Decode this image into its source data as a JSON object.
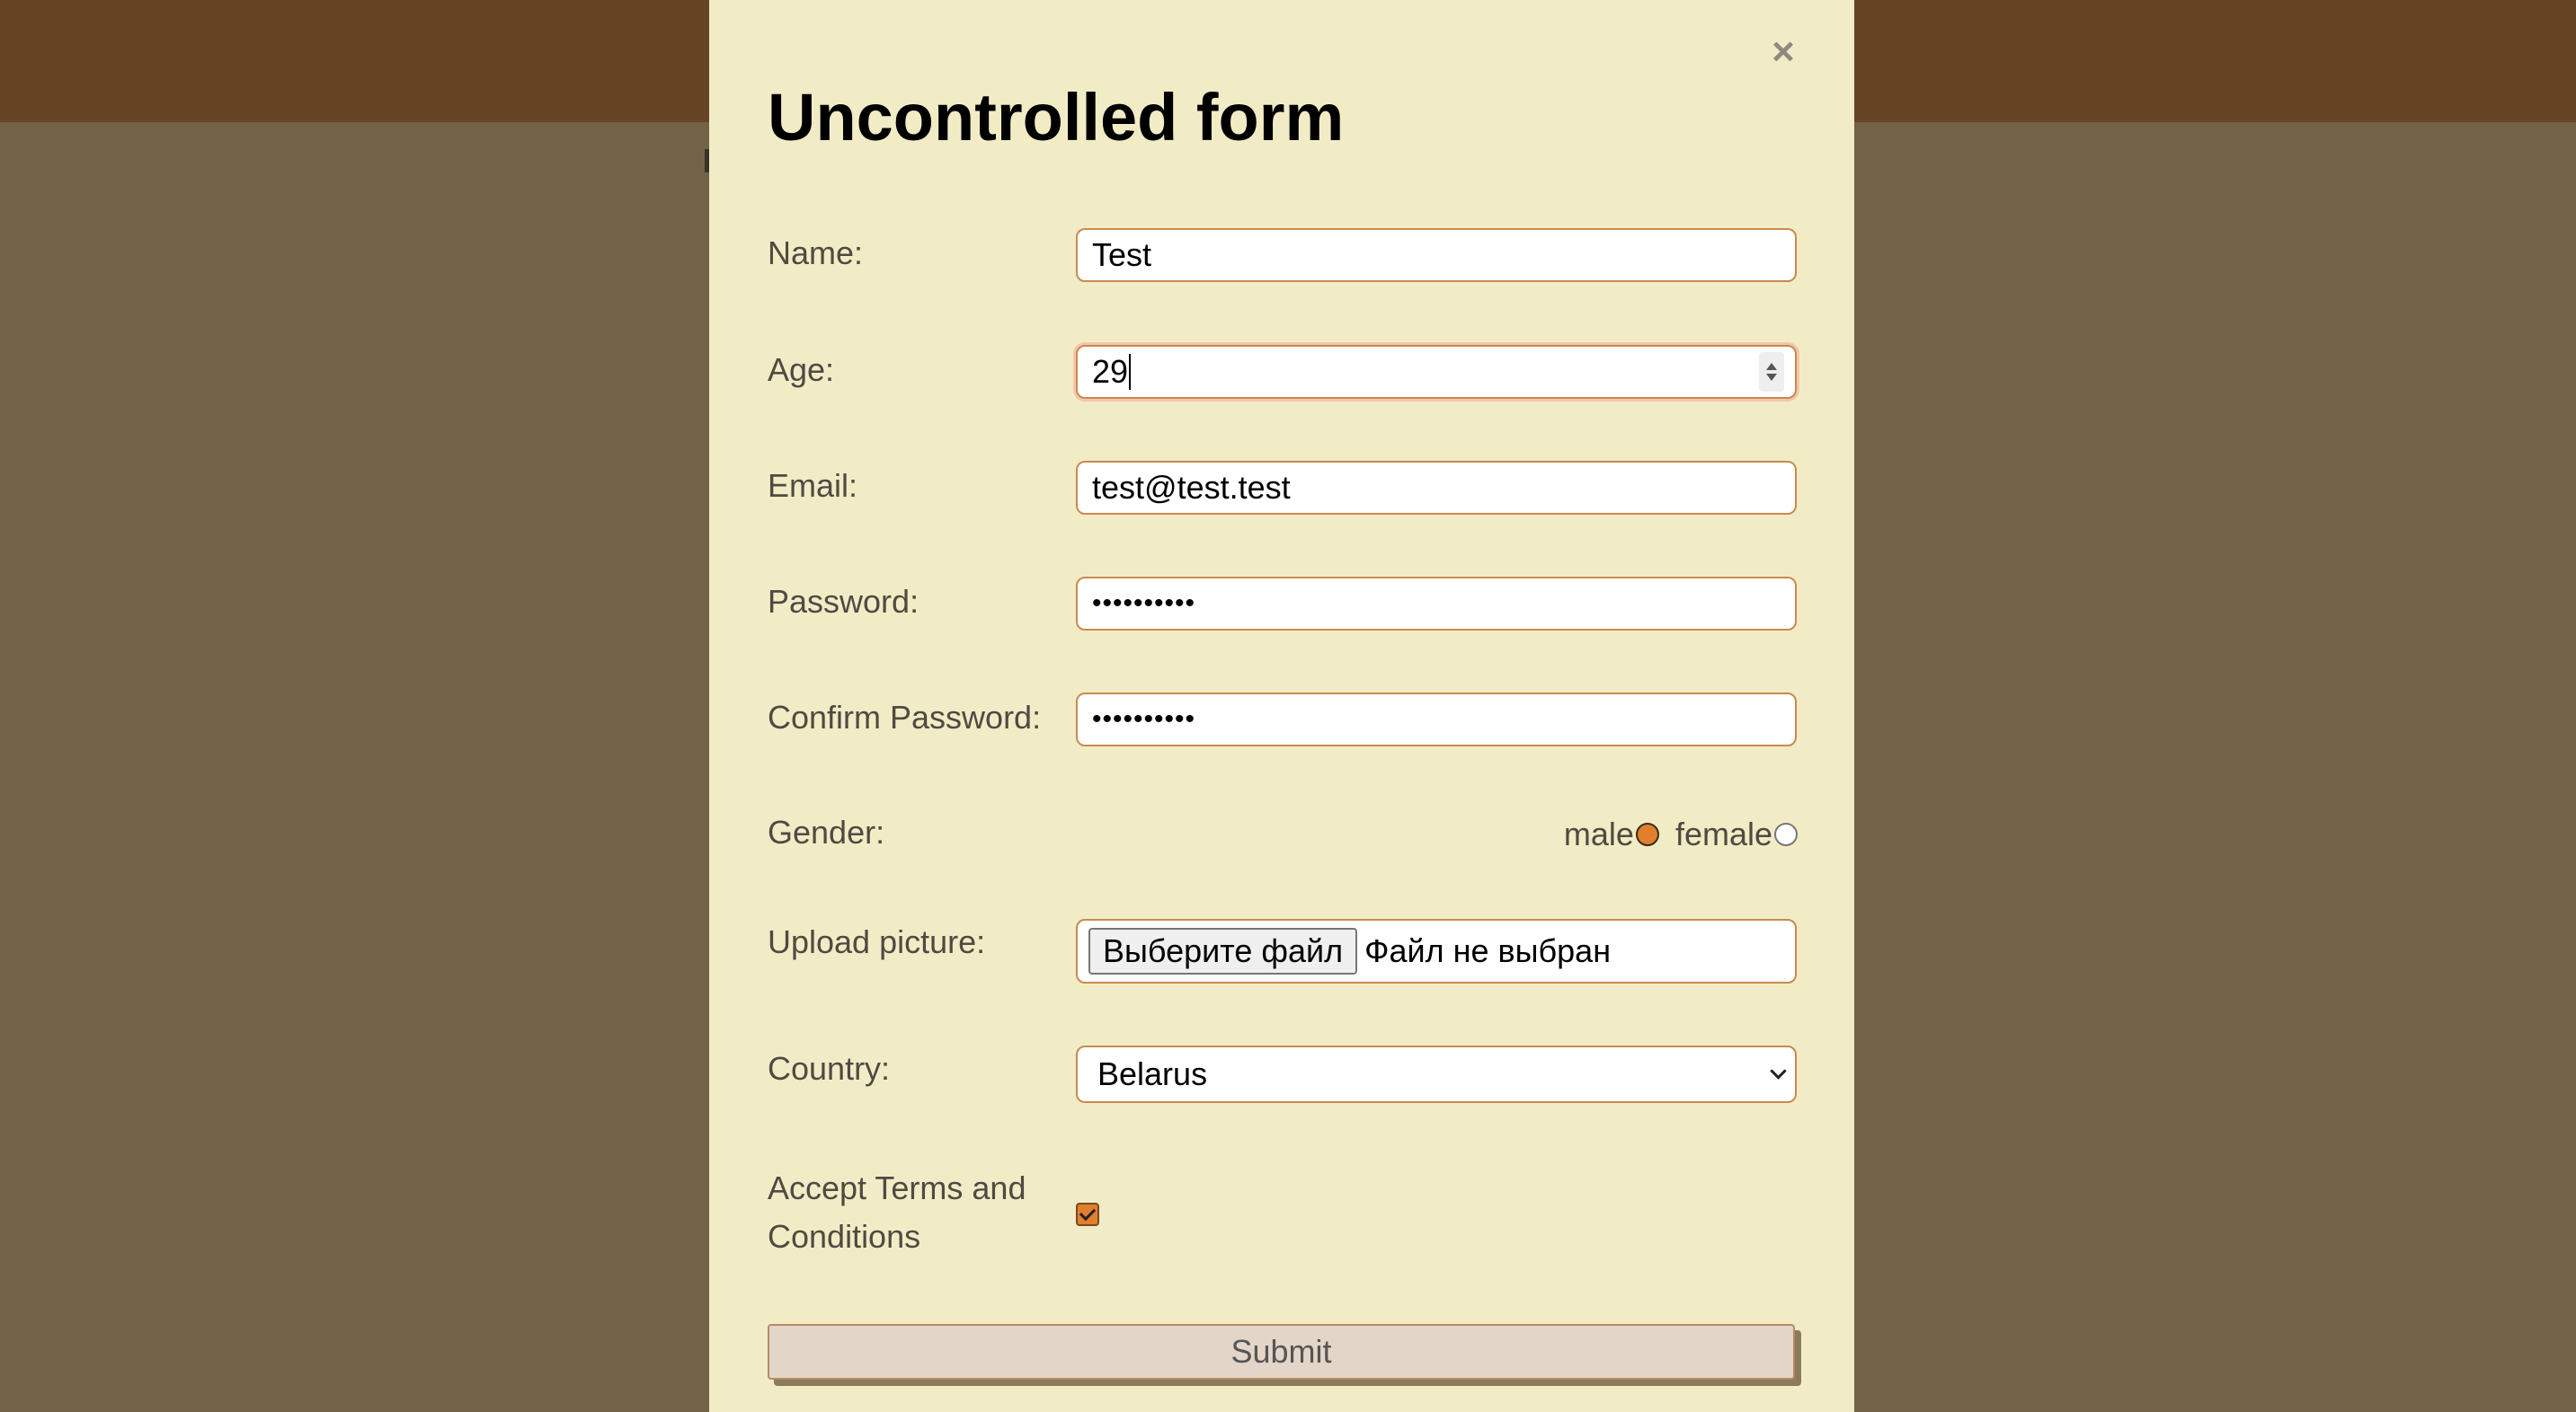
{
  "form": {
    "title": "Uncontrolled form",
    "close_label": "×",
    "name": {
      "label": "Name:",
      "value": "Test"
    },
    "age": {
      "label": "Age:",
      "value": "29"
    },
    "email": {
      "label": "Email:",
      "value": "test@test.test"
    },
    "password": {
      "label": "Password:",
      "value": "••••••••••"
    },
    "confirm_password": {
      "label": "Confirm Password:",
      "value": "••••••••••"
    },
    "gender": {
      "label": "Gender:",
      "options": [
        {
          "label": "male",
          "checked": true
        },
        {
          "label": "female",
          "checked": false
        }
      ]
    },
    "picture": {
      "label": "Upload picture:",
      "button_label": "Выберите файл",
      "status": "Файл не выбран"
    },
    "country": {
      "label": "Country:",
      "value": "Belarus"
    },
    "terms": {
      "label": "Accept Terms and Conditions",
      "checked": true
    },
    "submit_label": "Submit"
  },
  "colors": {
    "accent": "#e07f2c",
    "field_border": "#c98a4e",
    "modal_background": "#f2ecc6",
    "header_bar": "#664424",
    "backdrop": "#736246",
    "submit_background": "#e3d6c9"
  }
}
